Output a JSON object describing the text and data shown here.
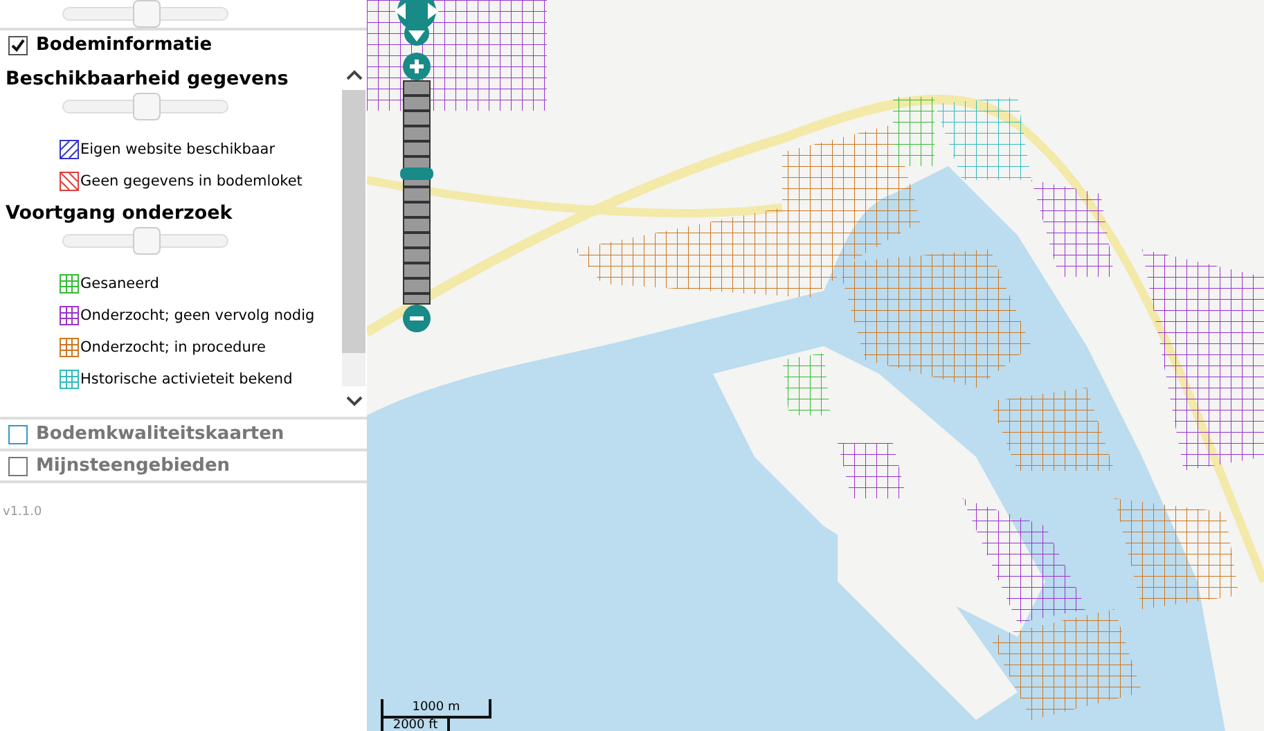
{
  "top_slider": {
    "level": 0.5
  },
  "layer": {
    "label": "Bodeminformatie",
    "checked": true
  },
  "groups": [
    {
      "title": "Beschikbaarheid gegevens",
      "slider": {
        "level": 0.5
      },
      "legend": [
        {
          "label": "Eigen website beschikbaar",
          "kind": "diagonal",
          "color": "#3333cc"
        },
        {
          "label": "Geen gegevens in bodemloket",
          "kind": "backslash",
          "color": "#e03c3c"
        }
      ]
    },
    {
      "title": "Voortgang onderzoek",
      "slider": {
        "level": 0.5
      },
      "legend": [
        {
          "label": "Gesaneerd",
          "kind": "grid",
          "color": "#33bb33"
        },
        {
          "label": "Onderzocht; geen vervolg nodig",
          "kind": "grid",
          "color": "#9933cc"
        },
        {
          "label": "Onderzocht; in procedure",
          "kind": "grid",
          "color": "#cc7722"
        },
        {
          "label": "Hstorische activieteit bekend",
          "kind": "grid",
          "color": "#33bbbb"
        }
      ]
    }
  ],
  "other_layers": [
    {
      "label": "Bodemkwaliteitskaarten",
      "checked": false,
      "color": "#3399cc"
    },
    {
      "label": "Mijnsteengebieden",
      "checked": false,
      "color": "#777777"
    }
  ],
  "version": "v1.1.0",
  "map": {
    "zoom": {
      "level": 0.59
    },
    "scale": [
      "1000 m",
      "2000 ft"
    ]
  }
}
